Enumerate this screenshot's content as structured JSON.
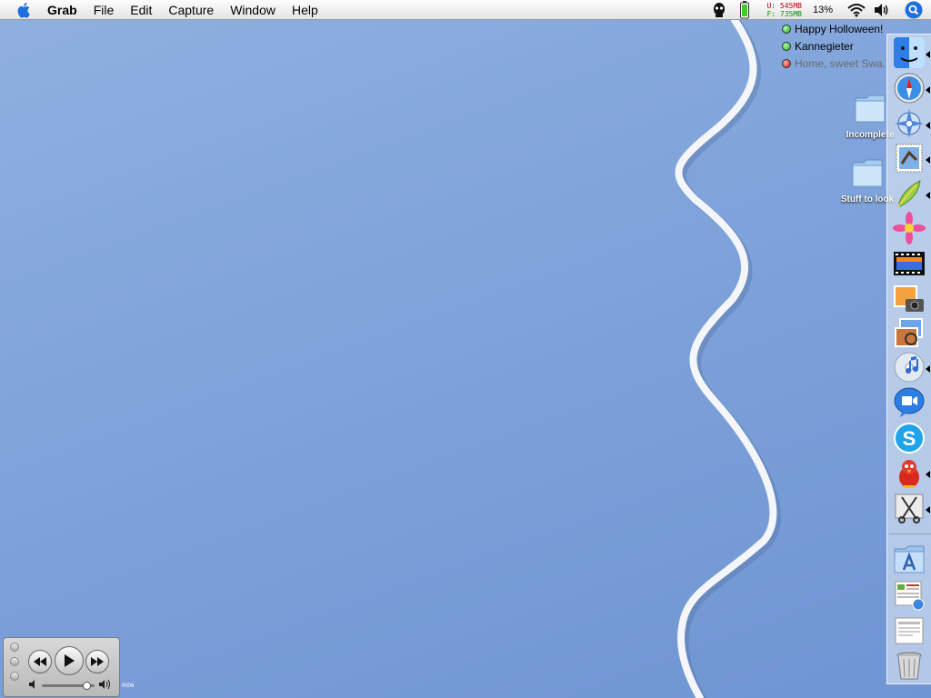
{
  "menubar": {
    "app_name": "Grab",
    "items": [
      "File",
      "Edit",
      "Capture",
      "Window",
      "Help"
    ],
    "memory_used": "U:  545MB",
    "memory_free": "F:  735MB",
    "cpu": "13%"
  },
  "buddies": [
    {
      "name": "Happy Holloween!",
      "status": "available"
    },
    {
      "name": "Kannegieter",
      "status": "available"
    },
    {
      "name": "Home, sweet Swa...",
      "status": "away"
    }
  ],
  "desktop": {
    "items": [
      {
        "label": "Incomplete",
        "icon": "folder-icon"
      },
      {
        "label": "Stuff to look",
        "icon": "folder-icon"
      }
    ]
  },
  "dock": {
    "apps": [
      {
        "name": "finder",
        "icon": "finder-icon"
      },
      {
        "name": "safari",
        "icon": "safari-icon"
      },
      {
        "name": "camino",
        "icon": "compass-icon"
      },
      {
        "name": "mail",
        "icon": "mail-stamp-icon"
      },
      {
        "name": "adium",
        "icon": "feather-icon"
      },
      {
        "name": "flower",
        "icon": "flower-icon"
      },
      {
        "name": "film",
        "icon": "film-icon"
      },
      {
        "name": "iphoto",
        "icon": "photo-camera-icon"
      },
      {
        "name": "preview",
        "icon": "photos-icon"
      },
      {
        "name": "itunes",
        "icon": "itunes-icon"
      },
      {
        "name": "ichat",
        "icon": "video-chat-icon"
      },
      {
        "name": "skype",
        "icon": "skype-icon"
      },
      {
        "name": "bird",
        "icon": "red-bird-icon"
      },
      {
        "name": "utility",
        "icon": "scissors-icon"
      }
    ],
    "others": [
      {
        "name": "applications",
        "icon": "applications-folder-icon"
      },
      {
        "name": "document1",
        "icon": "document-icon"
      },
      {
        "name": "document2",
        "icon": "document-icon"
      },
      {
        "name": "trash",
        "icon": "trash-icon"
      }
    ]
  },
  "controller": {
    "volume_level": 0.85,
    "caption": "0006"
  },
  "colors": {
    "desktop": "#7fa3da",
    "menubar": "#eeeeee",
    "available": "#1ca41c",
    "away": "#c01010"
  }
}
